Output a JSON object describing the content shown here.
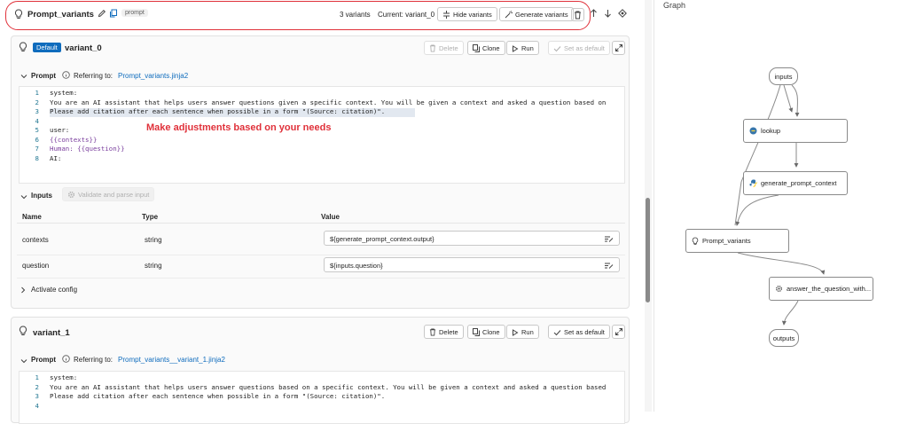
{
  "header": {
    "title": "Prompt_variants",
    "tag": "prompt",
    "variant_count": "3 variants",
    "current": "Current: variant_0",
    "hide_label": "Hide variants",
    "generate_label": "Generate variants"
  },
  "variant0": {
    "badge": "Default",
    "name": "variant_0",
    "delete_label": "Delete",
    "clone_label": "Clone",
    "run_label": "Run",
    "set_default_label": "Set as default",
    "prompt_label": "Prompt",
    "referring": "Referring to:",
    "file": "Prompt_variants.jinja2",
    "lines": [
      {
        "n": "1",
        "t": "system:"
      },
      {
        "n": "2",
        "t": "You are an AI assistant that helps users answer questions given a specific context. You will be given a context and asked a question based on"
      },
      {
        "n": "3",
        "t": "Please add citation after each sentence when possible in a form \"(Source: citation)\"."
      },
      {
        "n": "4",
        "t": ""
      },
      {
        "n": "5",
        "t": "user:"
      },
      {
        "n": "6",
        "t": "{{contexts}}"
      },
      {
        "n": "7",
        "t": "Human: {{question}}"
      },
      {
        "n": "8",
        "t": "AI:"
      }
    ],
    "annotation": "Make adjustments based on your needs",
    "inputs_label": "Inputs",
    "validate_label": "Validate and parse input",
    "columns": [
      "Name",
      "Type",
      "Value"
    ],
    "rows": [
      {
        "name": "contexts",
        "type": "string",
        "value": "${generate_prompt_context.output}"
      },
      {
        "name": "question",
        "type": "string",
        "value": "${inputs.question}"
      }
    ],
    "activate": "Activate config"
  },
  "variant1": {
    "name": "variant_1",
    "delete_label": "Delete",
    "clone_label": "Clone",
    "run_label": "Run",
    "set_default_label": "Set as default",
    "prompt_label": "Prompt",
    "referring": "Referring to:",
    "file": "Prompt_variants__variant_1.jinja2",
    "lines": [
      {
        "n": "1",
        "t": "system:"
      },
      {
        "n": "2",
        "t": "You are an AI assistant that helps users answer questions based on a specific context. You will be given a context and asked a question based"
      },
      {
        "n": "3",
        "t": "Please add citation after each sentence when possible in a form \"(Source: citation)\"."
      },
      {
        "n": "4",
        "t": ""
      }
    ]
  },
  "graph": {
    "title": "Graph",
    "inputs": "inputs",
    "lookup": "lookup",
    "generate": "generate_prompt_context",
    "prompt_variants": "Prompt_variants",
    "answer": "answer_the_question_with...",
    "outputs": "outputs"
  },
  "colors": {
    "accent": "#0f6cbd",
    "annotation": "#e0313a",
    "outline": "#e0313a"
  }
}
